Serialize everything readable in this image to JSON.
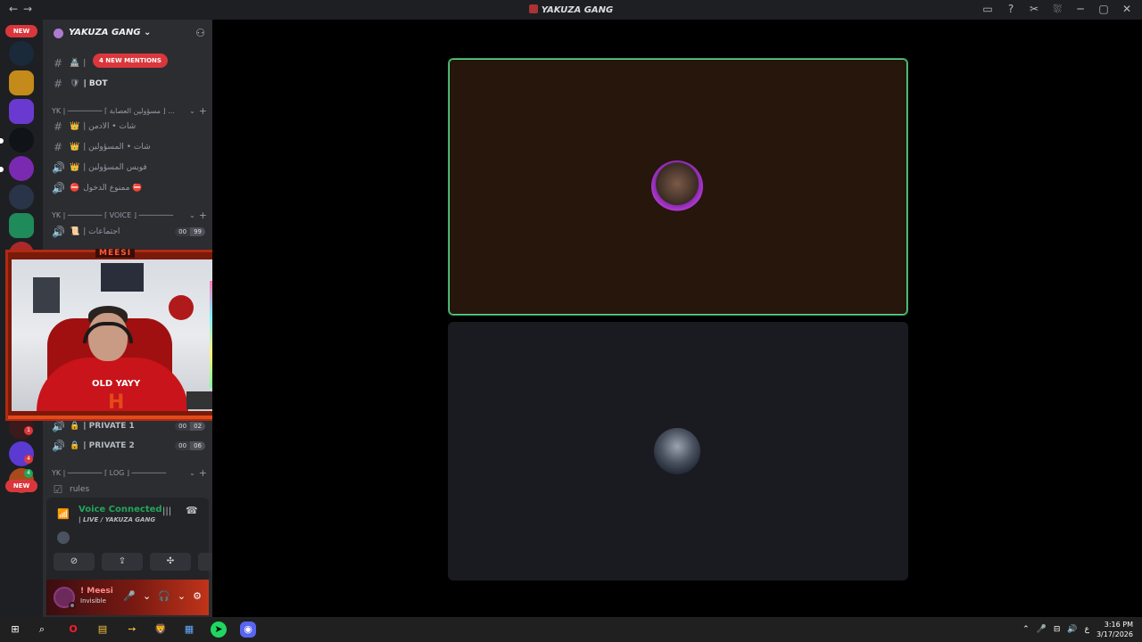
{
  "window": {
    "title": "YAKUZA GANG",
    "nav": "←→",
    "tools": [
      "▭",
      "?",
      "✂",
      "⛆",
      "─",
      "▢",
      "✕"
    ]
  },
  "guilds": {
    "new_top": "NEW",
    "new_bottom": "NEW",
    "badges": [
      "1",
      "4",
      "4"
    ],
    "colors": [
      "#1a2a3a",
      "#c48a1a",
      "#6a3ad0",
      "#101418",
      "#7a2ab0",
      "#2a3448",
      "#1f8a5a",
      "#aa2a2a",
      "#3a1a1a",
      "#5a3ad0",
      "#aa4a1a"
    ]
  },
  "server": {
    "name": "YAKUZA GANG ⌄",
    "invite_icon": "add-member-icon"
  },
  "mentions_banner": "4 NEW MENTIONS",
  "channels": {
    "top": [
      {
        "icon": "#",
        "emoji": "🏯",
        "label": "|"
      },
      {
        "icon": "#",
        "emoji": "🛡",
        "label": "| BOT"
      }
    ],
    "cat_admins": "YK | ──────── ⌈ مسؤولين العصابة ⌋ ...",
    "admins": [
      {
        "icon": "#",
        "emoji": "👑",
        "label": "| شات • الادمن"
      },
      {
        "icon": "#",
        "emoji": "👑",
        "label": "| شات • المسؤولين"
      },
      {
        "icon": "🔊",
        "emoji": "👑",
        "label": "| فويس المسؤولين"
      },
      {
        "icon": "🔊",
        "emoji": "⛔",
        "label": "ممنوع الدخول ⛔"
      }
    ],
    "cat_voice": "YK | ──────── ⌈ VOICE ⌋ ────────",
    "voice": [
      {
        "icon": "🔊",
        "emoji": "📜",
        "label": "| اجتماعات",
        "count_a": "00",
        "count_b": "99"
      }
    ],
    "private": [
      {
        "icon": "🔊",
        "emoji": "🔒",
        "label": "| PRIVATE 1",
        "count_a": "00",
        "count_b": "02"
      },
      {
        "icon": "🔊",
        "emoji": "🔒",
        "label": "| PRIVATE 2",
        "count_a": "00",
        "count_b": "06"
      }
    ],
    "cat_log": "YK | ──────── ⌈ LOG ⌋ ────────",
    "log": [
      {
        "icon": "☑",
        "emoji": "",
        "label": "rules"
      }
    ]
  },
  "voice_panel": {
    "status": "Voice Connected",
    "channel": "| LIVE / YAKUZA GANG",
    "buttons": [
      "⊘",
      "⇪",
      "✣",
      "✺"
    ],
    "wave": "|||",
    "disconnect": "☎"
  },
  "user": {
    "name": "! Meesi",
    "status": "Invisible",
    "controls": [
      "🎤",
      "⌄",
      "🎧",
      "⌄",
      "⚙"
    ]
  },
  "stream": {
    "label": "MEESI",
    "shirt_text": "OLD YAYY",
    "mark": "H"
  },
  "taskbar": {
    "icons": [
      "⊞",
      "⌕",
      "O",
      "▤",
      "➙",
      "🦁",
      "▦",
      "➤",
      "◉"
    ],
    "tray": [
      "⌃",
      "🎤",
      "⊟",
      "🔊",
      "ع"
    ],
    "time": "3:16 PM",
    "date": "3/17/2026"
  }
}
